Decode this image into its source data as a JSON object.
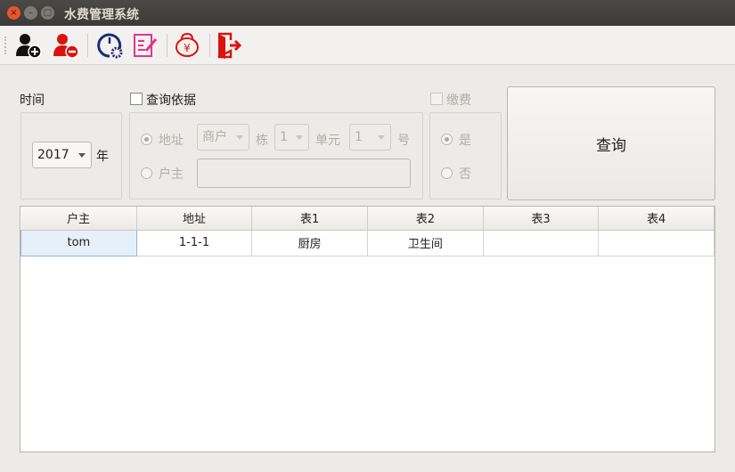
{
  "window": {
    "title": "水费管理系统"
  },
  "toolbar": {
    "items": [
      {
        "name": "add-user-icon"
      },
      {
        "name": "remove-user-icon"
      },
      {
        "name": "settings-meter-icon"
      },
      {
        "name": "edit-document-icon"
      },
      {
        "name": "money-bag-icon",
        "symbol": "¥"
      },
      {
        "name": "exit-icon"
      }
    ]
  },
  "filters": {
    "time_label": "时间",
    "year": "2017",
    "year_unit": "年",
    "query_basis_label": "查询依据",
    "address_label": "地址",
    "address_type": "商户",
    "building_label": "栋",
    "building": "1",
    "unit_label": "单元",
    "unit": "1",
    "number_label": "号",
    "owner_label": "户主",
    "owner_value": "",
    "paid_label": "缴费",
    "yes_label": "是",
    "no_label": "否",
    "query_button": "查询"
  },
  "table": {
    "headers": [
      "户主",
      "地址",
      "表1",
      "表2",
      "表3",
      "表4"
    ],
    "rows": [
      [
        "tom",
        "1-1-1",
        "厨房",
        "卫生间",
        "",
        ""
      ]
    ]
  }
}
